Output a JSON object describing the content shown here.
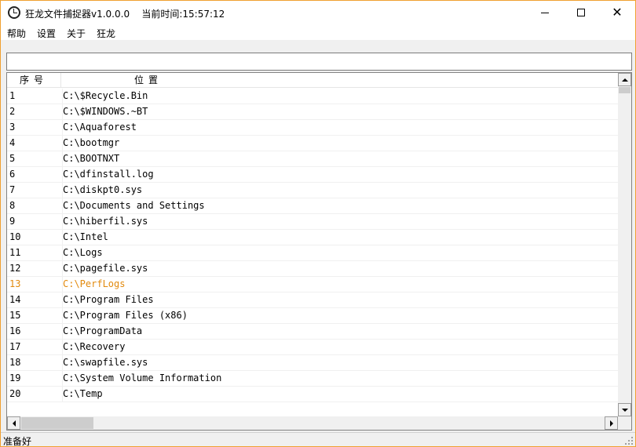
{
  "window": {
    "title": "狂龙文件捕捉器v1.0.0.0    当前时间:15:57:12",
    "icon": "clock-icon",
    "accent_border": "#f0a030"
  },
  "menu": {
    "items": [
      "帮助",
      "设置",
      "关于",
      "狂龙"
    ]
  },
  "path_input": {
    "value": "",
    "placeholder": ""
  },
  "list": {
    "columns": [
      "序号",
      "位置"
    ],
    "highlight_color": "#e28a0e",
    "rows": [
      {
        "no": "1",
        "path": "C:\\$Recycle.Bin"
      },
      {
        "no": "2",
        "path": "C:\\$WINDOWS.~BT"
      },
      {
        "no": "3",
        "path": "C:\\Aquaforest"
      },
      {
        "no": "4",
        "path": "C:\\bootmgr"
      },
      {
        "no": "5",
        "path": "C:\\BOOTNXT"
      },
      {
        "no": "6",
        "path": "C:\\dfinstall.log"
      },
      {
        "no": "7",
        "path": "C:\\diskpt0.sys"
      },
      {
        "no": "8",
        "path": "C:\\Documents and Settings"
      },
      {
        "no": "9",
        "path": "C:\\hiberfil.sys"
      },
      {
        "no": "10",
        "path": "C:\\Intel"
      },
      {
        "no": "11",
        "path": "C:\\Logs"
      },
      {
        "no": "12",
        "path": "C:\\pagefile.sys"
      },
      {
        "no": "13",
        "path": "C:\\PerfLogs",
        "highlight": true
      },
      {
        "no": "14",
        "path": "C:\\Program Files"
      },
      {
        "no": "15",
        "path": "C:\\Program Files (x86)"
      },
      {
        "no": "16",
        "path": "C:\\ProgramData"
      },
      {
        "no": "17",
        "path": "C:\\Recovery"
      },
      {
        "no": "18",
        "path": "C:\\swapfile.sys"
      },
      {
        "no": "19",
        "path": "C:\\System Volume Information"
      },
      {
        "no": "20",
        "path": "C:\\Temp"
      }
    ]
  },
  "status": {
    "text": "准备好"
  }
}
